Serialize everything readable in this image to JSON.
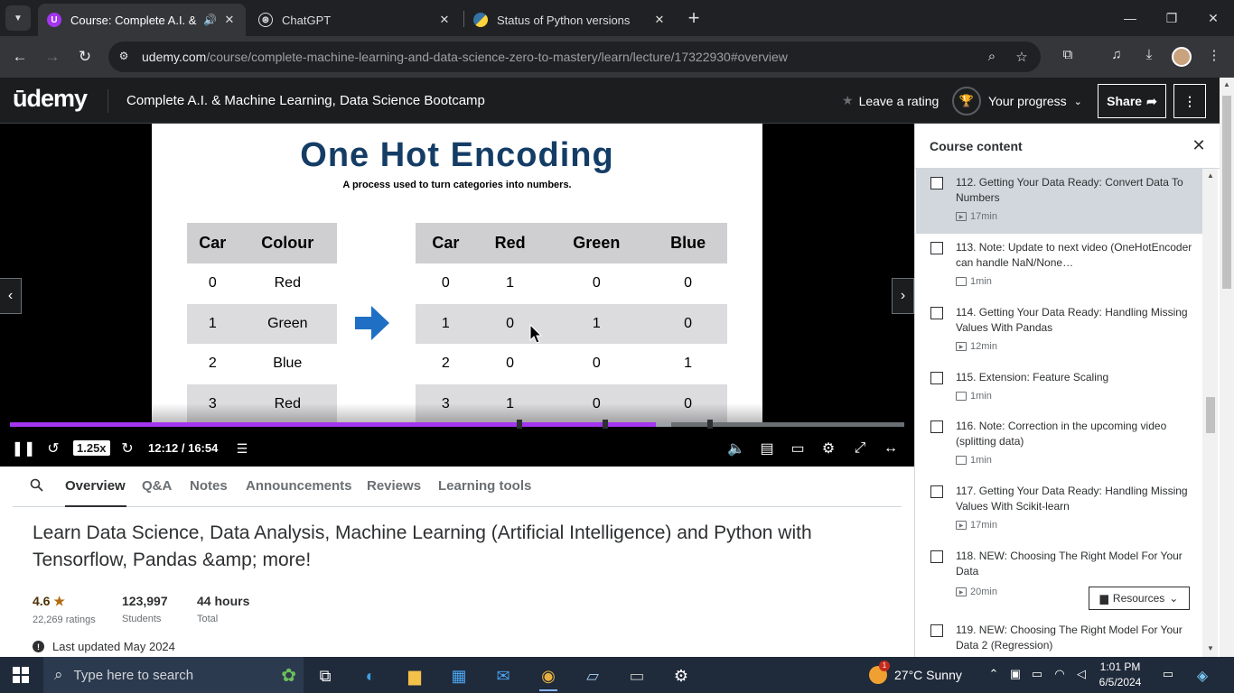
{
  "browser": {
    "tabs": [
      {
        "title": "Course: Complete A.I. & Ma",
        "favicon": "udemy-icon",
        "muted_icon": "speaker-icon"
      },
      {
        "title": "ChatGPT",
        "favicon": "chatgpt-icon"
      },
      {
        "title": "Status of Python versions",
        "favicon": "python-icon"
      }
    ],
    "url_host": "udemy.com",
    "url_path": "/course/complete-machine-learning-and-data-science-zero-to-mastery/learn/lecture/17322930#overview"
  },
  "header": {
    "logo": "ūdemy",
    "course_title": "Complete A.I. & Machine Learning, Data Science Bootcamp",
    "leave_rating": "Leave a rating",
    "your_progress": "Your progress",
    "share": "Share"
  },
  "slide": {
    "title": "One Hot Encoding",
    "subtitle": "A process used to turn categories into numbers.",
    "left_table": {
      "headers": [
        "Car",
        "Colour"
      ],
      "rows": [
        [
          "0",
          "Red"
        ],
        [
          "1",
          "Green"
        ],
        [
          "2",
          "Blue"
        ],
        [
          "3",
          "Red"
        ]
      ]
    },
    "right_table": {
      "headers": [
        "Car",
        "Red",
        "Green",
        "Blue"
      ],
      "rows": [
        [
          "0",
          "1",
          "0",
          "0"
        ],
        [
          "1",
          "0",
          "1",
          "0"
        ],
        [
          "2",
          "0",
          "0",
          "1"
        ],
        [
          "3",
          "1",
          "0",
          "0"
        ]
      ]
    }
  },
  "player": {
    "speed": "1.25x",
    "time": "12:12 / 16:54",
    "progress_fraction": 0.722,
    "buffered_fraction": 0.739
  },
  "tabs": {
    "items": [
      "Overview",
      "Q&A",
      "Notes",
      "Announcements",
      "Reviews",
      "Learning tools"
    ],
    "active": "Overview"
  },
  "overview": {
    "title": "Learn Data Science, Data Analysis, Machine Learning (Artificial Intelligence) and Python with Tensorflow, Pandas &amp; more!",
    "rating_value": "4.6",
    "rating_label": "22,269 ratings",
    "students_value": "123,997",
    "students_label": "Students",
    "hours_value": "44 hours",
    "hours_label": "Total",
    "last_updated": "Last updated May 2024"
  },
  "sidebar": {
    "heading": "Course content",
    "lectures": [
      {
        "title": "112. Getting Your Data Ready: Convert Data To Numbers",
        "duration": "17min",
        "type": "video",
        "current": true
      },
      {
        "title": "113. Note: Update to next video (OneHotEncoder can handle NaN/None…",
        "duration": "1min",
        "type": "article"
      },
      {
        "title": "114. Getting Your Data Ready: Handling Missing Values With Pandas",
        "duration": "12min",
        "type": "video"
      },
      {
        "title": "115. Extension: Feature Scaling",
        "duration": "1min",
        "type": "article"
      },
      {
        "title": "116. Note: Correction in the upcoming video (splitting data)",
        "duration": "1min",
        "type": "article"
      },
      {
        "title": "117. Getting Your Data Ready: Handling Missing Values With Scikit-learn",
        "duration": "17min",
        "type": "video"
      },
      {
        "title": "118. NEW: Choosing The Right Model For Your Data",
        "duration": "20min",
        "type": "video"
      },
      {
        "title": "119. NEW: Choosing The Right Model For Your Data 2 (Regression)",
        "duration": "",
        "type": "video"
      }
    ],
    "resources": "Resources"
  },
  "taskbar": {
    "search_placeholder": "Type here to search",
    "weather": "27°C  Sunny",
    "weather_badge": "1",
    "time": "1:01 PM",
    "date": "6/5/2024"
  },
  "colors": {
    "udemy_purple": "#a435f0",
    "udemy_dark": "#1c1d1f",
    "slide_title": "#143d66",
    "arrow_blue": "#1f6fc5"
  }
}
